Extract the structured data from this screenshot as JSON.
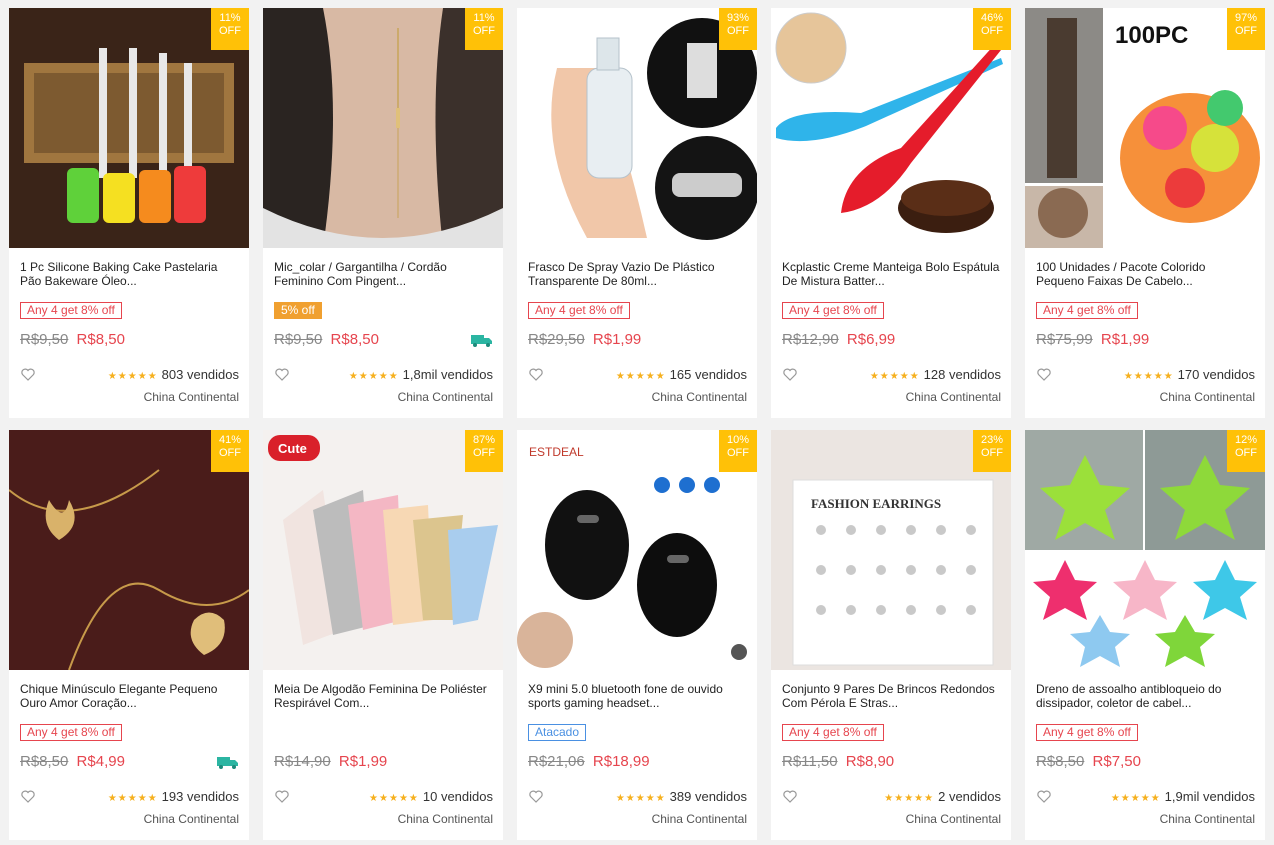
{
  "products": [
    {
      "title": "1 Pc Silicone Baking Cake Pastelaria Pão Bakeware Óleo...",
      "badge_pct": "11%",
      "badge_off": "OFF",
      "tag": "Any 4 get 8% off",
      "tag_style": "outline",
      "old_price": "R$9,50",
      "new_price": "R$8,50",
      "free_shipping": false,
      "sold": "803 vendidos",
      "origin": "China Continental",
      "image": "silicone-brushes"
    },
    {
      "title": "Mic_colar / Gargantilha / Cordão Feminino Com Pingent...",
      "badge_pct": "11%",
      "badge_off": "OFF",
      "tag": "5% off",
      "tag_style": "solid",
      "old_price": "R$9,50",
      "new_price": "R$8,50",
      "free_shipping": true,
      "sold": "1,8mil vendidos",
      "origin": "China Continental",
      "image": "necklace-model"
    },
    {
      "title": "Frasco De Spray Vazio De Plástico Transparente De 80ml...",
      "badge_pct": "93%",
      "badge_off": "OFF",
      "tag": "Any 4 get 8% off",
      "tag_style": "outline",
      "old_price": "R$29,50",
      "new_price": "R$1,99",
      "free_shipping": false,
      "sold": "165 vendidos",
      "origin": "China Continental",
      "image": "spray-bottle"
    },
    {
      "title": "Kcplastic Creme Manteiga Bolo Espátula De Mistura Batter...",
      "badge_pct": "46%",
      "badge_off": "OFF",
      "tag": "Any 4 get 8% off",
      "tag_style": "outline",
      "old_price": "R$12,90",
      "new_price": "R$6,99",
      "free_shipping": false,
      "sold": "128 vendidos",
      "origin": "China Continental",
      "image": "spatulas"
    },
    {
      "title": "100 Unidades / Pacote Colorido Pequeno Faixas De Cabelo...",
      "badge_pct": "97%",
      "badge_off": "OFF",
      "tag": "Any 4 get 8% off",
      "tag_style": "outline",
      "old_price": "R$75,99",
      "new_price": "R$1,99",
      "free_shipping": false,
      "sold": "170 vendidos",
      "origin": "China Continental",
      "image": "hair-bands",
      "image_text": "100PC"
    },
    {
      "title": "Chique Minúsculo Elegante Pequeno Ouro Amor Coração...",
      "badge_pct": "41%",
      "badge_off": "OFF",
      "tag": "Any 4 get 8% off",
      "tag_style": "outline",
      "old_price": "R$8,50",
      "new_price": "R$4,99",
      "free_shipping": true,
      "sold": "193 vendidos",
      "origin": "China Continental",
      "image": "heart-necklace"
    },
    {
      "title": "Meia De Algodão Feminina De Poliéster Respirável Com...",
      "badge_pct": "87%",
      "badge_off": "OFF",
      "tag": "",
      "tag_style": "none",
      "old_price": "R$14,90",
      "new_price": "R$1,99",
      "free_shipping": false,
      "sold": "10 vendidos",
      "origin": "China Continental",
      "image": "cat-socks",
      "image_text": "Cute"
    },
    {
      "title": "X9 mini 5.0 bluetooth fone de ouvido sports gaming headset...",
      "badge_pct": "10%",
      "badge_off": "OFF",
      "tag": "Atacado",
      "tag_style": "blue",
      "old_price": "R$21,06",
      "new_price": "R$18,99",
      "free_shipping": false,
      "sold": "389 vendidos",
      "origin": "China Continental",
      "image": "earbuds",
      "image_text": "ESTDEAL"
    },
    {
      "title": "Conjunto 9 Pares De Brincos Redondos Com Pérola E Stras...",
      "badge_pct": "23%",
      "badge_off": "OFF",
      "tag": "Any 4 get 8% off",
      "tag_style": "outline",
      "old_price": "R$11,50",
      "new_price": "R$8,90",
      "free_shipping": false,
      "sold": "2 vendidos",
      "origin": "China Continental",
      "image": "earrings-card",
      "image_text": "FASHION EARRINGS"
    },
    {
      "title": "Dreno de assoalho antibloqueio do dissipador, coletor de cabel...",
      "badge_pct": "12%",
      "badge_off": "OFF",
      "tag": "Any 4 get 8% off",
      "tag_style": "outline",
      "old_price": "R$8,50",
      "new_price": "R$7,50",
      "free_shipping": false,
      "sold": "1,9mil vendidos",
      "origin": "China Continental",
      "image": "star-drains"
    }
  ],
  "colors": {
    "price": "#e6454e",
    "badge": "#ffc107",
    "stars": "#f6b01e",
    "shipping": "#2bb5a2"
  },
  "rating_stars": "★★★★★"
}
